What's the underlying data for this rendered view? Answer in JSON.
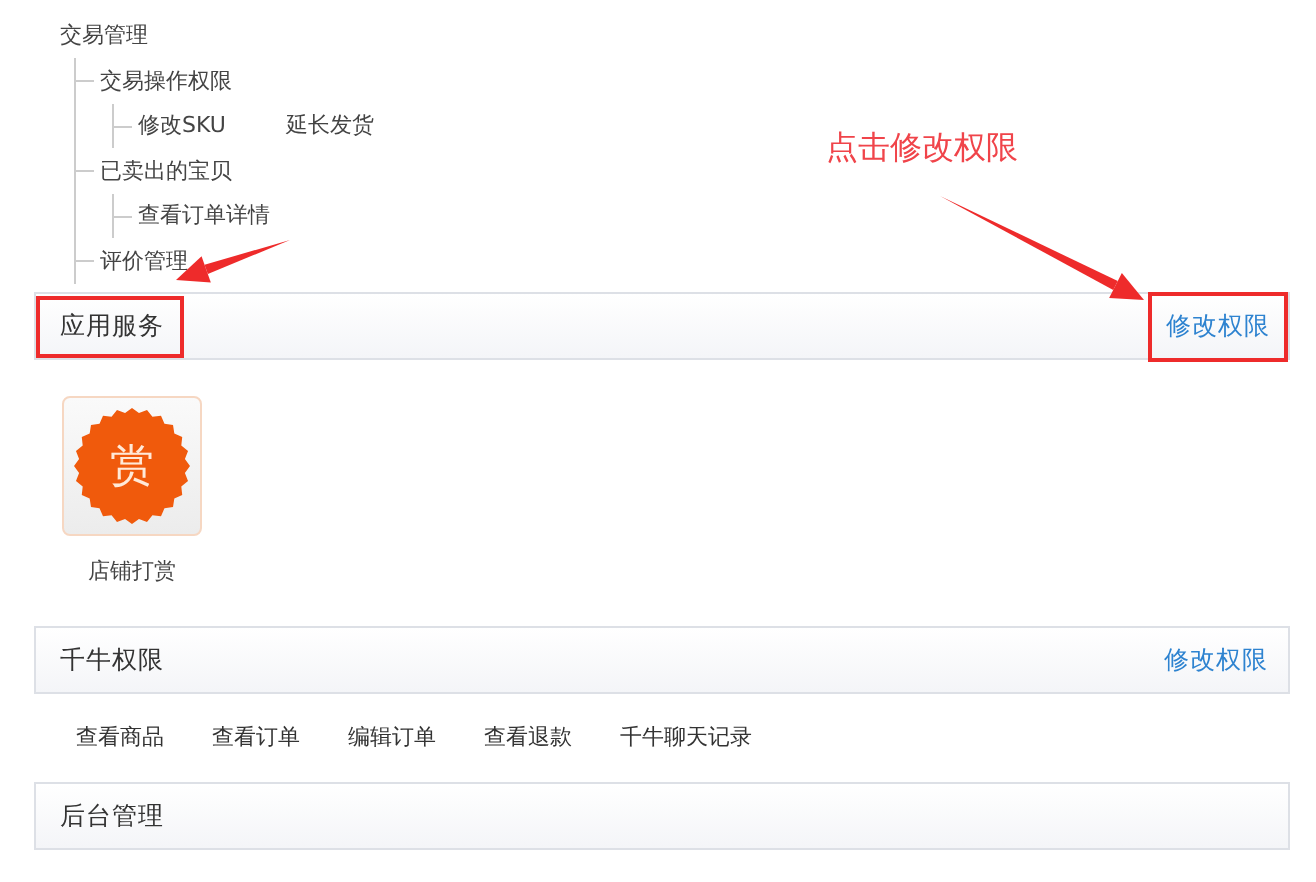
{
  "tree": {
    "label": "交易管理",
    "children": [
      {
        "label": "交易操作权限",
        "children": [
          {
            "label": "修改SKU"
          },
          {
            "label": "延长发货"
          }
        ]
      },
      {
        "label": "已卖出的宝贝",
        "children": [
          {
            "label": "查看订单详情"
          }
        ]
      },
      {
        "label": "评价管理"
      }
    ]
  },
  "sections": [
    {
      "title": "应用服务",
      "link": "修改权限",
      "title_marked": true,
      "link_marked": true,
      "apps": [
        {
          "label": "店铺打赏",
          "badge": "赏"
        }
      ]
    },
    {
      "title": "千牛权限",
      "link": "修改权限",
      "title_marked": false,
      "link_marked": false,
      "permissions": [
        "查看商品",
        "查看订单",
        "编辑订单",
        "查看退款",
        "千牛聊天记录"
      ]
    },
    {
      "title": "后台管理",
      "title_marked": false
    }
  ],
  "annotation": {
    "text": "点击修改权限"
  }
}
